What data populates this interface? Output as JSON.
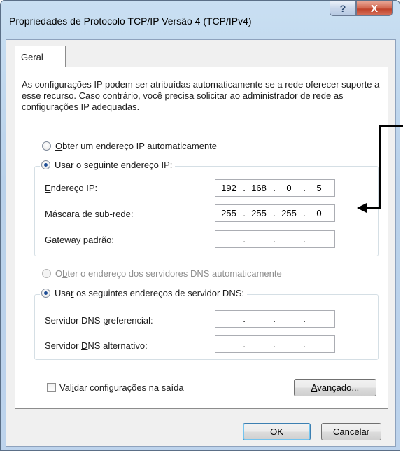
{
  "window": {
    "title": "Propriedades de Protocolo TCP/IP Versão 4 (TCP/IPv4)",
    "help_glyph": "?",
    "close_glyph": "X"
  },
  "tabs": [
    {
      "label": "Geral",
      "selected": true
    }
  ],
  "description": "As configurações IP podem ser atribuídas automaticamente se a rede oferecer suporte a esse recurso. Caso contrário, você precisa solicitar ao administrador de rede as configurações IP adequadas.",
  "ip_section": {
    "auto": {
      "pre": "",
      "mnemonic": "O",
      "post": "bter um endereço IP automaticamente",
      "selected": false
    },
    "manual": {
      "pre": "",
      "mnemonic": "U",
      "post": "sar o seguinte endereço IP:",
      "selected": true
    },
    "fields": [
      {
        "pre": "",
        "mnemonic": "E",
        "post": "ndereço IP:",
        "octets": [
          "192",
          "168",
          "0",
          "5"
        ]
      },
      {
        "pre": "",
        "mnemonic": "M",
        "post": "áscara de sub-rede:",
        "octets": [
          "255",
          "255",
          "255",
          "0"
        ]
      },
      {
        "pre": "",
        "mnemonic": "G",
        "post": "ateway padrão:",
        "octets": [
          "",
          "",
          "",
          ""
        ]
      }
    ]
  },
  "dns_section": {
    "auto": {
      "pre": "O",
      "mnemonic": "b",
      "post": "ter o endereço dos servidores DNS automaticamente",
      "selected": false,
      "disabled": true
    },
    "manual": {
      "pre": "Usa",
      "mnemonic": "r",
      "post": " os seguintes endereços de servidor DNS:",
      "selected": true
    },
    "fields": [
      {
        "pre": "Servidor DNS ",
        "mnemonic": "p",
        "post": "referencial:",
        "octets": [
          "",
          "",
          "",
          ""
        ]
      },
      {
        "pre": "Servidor ",
        "mnemonic": "D",
        "post": "NS alternativo:",
        "octets": [
          "",
          "",
          "",
          ""
        ]
      }
    ]
  },
  "validate": {
    "pre": "Val",
    "mnemonic": "i",
    "post": "dar configurações na saída",
    "checked": false
  },
  "buttons": {
    "advanced": {
      "pre": "",
      "mnemonic": "A",
      "post": "vançado..."
    },
    "ok": "OK",
    "cancel": "Cancelar"
  },
  "colors": {
    "title_bar": "#bdd3ec",
    "close_button": "#c0432b",
    "group_border": "#d5dfe5",
    "annotation_arrow": "#000000"
  }
}
